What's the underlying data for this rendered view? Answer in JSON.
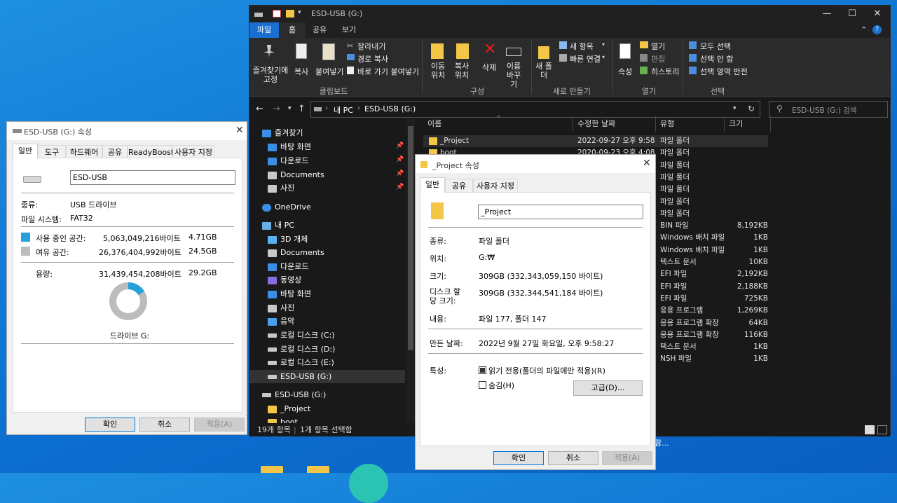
{
  "explorer": {
    "title": "ESD-USB (G:)",
    "ribbon_tabs": [
      "파일",
      "홈",
      "공유",
      "보기"
    ],
    "ribbon": {
      "pin_quick": "즐겨찾기에 고정",
      "copy": "복사",
      "paste": "붙여넣기",
      "cut": "잘라내기",
      "copy_path": "경로 복사",
      "paste_shortcut": "바로 가기 붙여넣기",
      "move_to": "이동 위치",
      "copy_to": "복사 위치",
      "delete": "삭제",
      "rename": "이름 바꾸기",
      "new_folder": "새 폴더",
      "new_item": "새 항목",
      "easy_access": "빠른 연결",
      "properties": "속성",
      "open": "열기",
      "edit": "편집",
      "history": "히스토리",
      "select_all": "모두 선택",
      "select_none": "선택 안 함",
      "invert_selection": "선택 영역 반전",
      "group_clipboard": "클립보드",
      "group_organize": "구성",
      "group_new": "새로 만들기",
      "group_open": "열기",
      "group_select": "선택"
    },
    "address": {
      "this_pc": "내 PC",
      "drive": "ESD-USB (G:)",
      "search_placeholder": "ESD-USB (G:) 검색"
    },
    "nav": [
      {
        "label": "즐겨찾기",
        "color": "#3a8ee6"
      },
      {
        "label": "바탕 화면",
        "color": "#3a8ee6",
        "pinned": true
      },
      {
        "label": "다운로드",
        "color": "#3a8ee6",
        "pinned": true
      },
      {
        "label": "Documents",
        "color": "#c8c8c8",
        "pinned": true
      },
      {
        "label": "사진",
        "color": "#c8c8c8",
        "pinned": true
      },
      {
        "label": "OneDrive",
        "color": "#3a8ee6"
      },
      {
        "label": "내 PC",
        "color": "#6aaee6"
      },
      {
        "label": "3D 개체",
        "color": "#5ab0f0"
      },
      {
        "label": "Documents",
        "color": "#c8c8c8"
      },
      {
        "label": "다운로드",
        "color": "#3a8ee6"
      },
      {
        "label": "동영상",
        "color": "#8a6ae0"
      },
      {
        "label": "바탕 화면",
        "color": "#3a8ee6"
      },
      {
        "label": "사진",
        "color": "#c8c8c8"
      },
      {
        "label": "음악",
        "color": "#4aa0f0"
      },
      {
        "label": "로컬 디스크 (C:)",
        "color": "#c8c8c8"
      },
      {
        "label": "로컬 디스크 (D:)",
        "color": "#c8c8c8"
      },
      {
        "label": "로컬 디스크 (E:)",
        "color": "#c8c8c8"
      },
      {
        "label": "ESD-USB (G:)",
        "color": "#c8c8c8"
      },
      {
        "label": "ESD-USB (G:)",
        "color": "#c8c8c8"
      },
      {
        "label": "_Project",
        "color": "#f3c648"
      },
      {
        "label": "boot",
        "color": "#f3c648"
      }
    ],
    "columns": [
      "이름",
      "수정한 날짜",
      "유형",
      "크기"
    ],
    "files": [
      {
        "name": "_Project",
        "date": "2022-09-27 오후 9:58",
        "type": "파일 폴더",
        "size": ""
      },
      {
        "name": "boot",
        "date": "2020-09-23 오후 4:08",
        "type": "파일 폴더",
        "size": ""
      },
      {
        "name": "",
        "date": "",
        "type": "파일 폴더",
        "size": ""
      },
      {
        "name": "",
        "date": "",
        "type": "파일 폴더",
        "size": ""
      },
      {
        "name": "",
        "date": "",
        "type": "파일 폴더",
        "size": ""
      },
      {
        "name": "",
        "date": "",
        "type": "파일 폴더",
        "size": ""
      },
      {
        "name": "",
        "date": "",
        "type": "파일 폴더",
        "size": ""
      },
      {
        "name": "",
        "date": "",
        "type": "BIN 파일",
        "size": "8,192KB"
      },
      {
        "name": "",
        "date": "",
        "type": "Windows 배치 파일",
        "size": "1KB"
      },
      {
        "name": "",
        "date": "",
        "type": "Windows 배치 파일",
        "size": "1KB"
      },
      {
        "name": "",
        "date": "",
        "type": "텍스트 문서",
        "size": "10KB"
      },
      {
        "name": "",
        "date": "",
        "type": "EFI 파일",
        "size": "2,192KB"
      },
      {
        "name": "",
        "date": "",
        "type": "EFI 파일",
        "size": "2,188KB"
      },
      {
        "name": "",
        "date": "",
        "type": "EFI 파일",
        "size": "725KB"
      },
      {
        "name": "",
        "date": "",
        "type": "응용 프로그램",
        "size": "1,269KB"
      },
      {
        "name": "",
        "date": "",
        "type": "응용 프로그램 확장",
        "size": "64KB"
      },
      {
        "name": "",
        "date": "",
        "type": "응용 프로그램 확장",
        "size": "116KB"
      },
      {
        "name": "",
        "date": "",
        "type": "텍스트 문서",
        "size": "1KB"
      },
      {
        "name": "",
        "date": "",
        "type": "NSH 파일",
        "size": "1KB"
      }
    ],
    "status_items": "19개 항목",
    "status_selected": "1개 항목 선택함",
    "overflow_text": "람..."
  },
  "drive_props": {
    "title": "ESD-USB (G:) 속성",
    "tabs": [
      "일반",
      "도구",
      "하드웨어",
      "공유",
      "ReadyBoost",
      "사용자 지정"
    ],
    "name_value": "ESD-USB",
    "type_label": "종류:",
    "type_value": "USB 드라이브",
    "fs_label": "파일 시스템:",
    "fs_value": "FAT32",
    "used_label": "사용 중인 공간:",
    "used_bytes": "5,063,049,216바이트",
    "used_gb": "4.71GB",
    "free_label": "여유 공간:",
    "free_bytes": "26,376,404,992바이트",
    "free_gb": "24.5GB",
    "capacity_label": "용량:",
    "capacity_bytes": "31,439,454,208바이트",
    "capacity_gb": "29.2GB",
    "used_fraction": 0.161,
    "used_color": "#26a0da",
    "free_color": "#bcbcbc",
    "drive_label": "드라이브 G:",
    "ok": "확인",
    "cancel": "취소",
    "apply": "적용(A)"
  },
  "folder_props": {
    "title": "_Project 속성",
    "tabs": [
      "일반",
      "공유",
      "사용자 지정"
    ],
    "name_value": "_Project",
    "type_label": "종류:",
    "type_value": "파일 폴더",
    "location_label": "위치:",
    "location_value": "G:₩",
    "size_label": "크기:",
    "size_value": "309GB (332,343,059,150 바이트)",
    "disk_size_label": "디스크 할\n당 크기:",
    "disk_size_value": "309GB (332,344,541,184 바이트)",
    "contains_label": "내용:",
    "contains_value": "파일 177, 폴더 147",
    "created_label": "만든 날짜:",
    "created_value": "2022년 9월 27일 화요일, 오후 9:58:27",
    "attr_label": "특성:",
    "readonly_label": "읽기 전용(폴더의 파일에만 적용)(R)",
    "hidden_label": "숨김(H)",
    "advanced": "고급(D)...",
    "ok": "확인",
    "cancel": "취소",
    "apply": "적용(A)"
  }
}
